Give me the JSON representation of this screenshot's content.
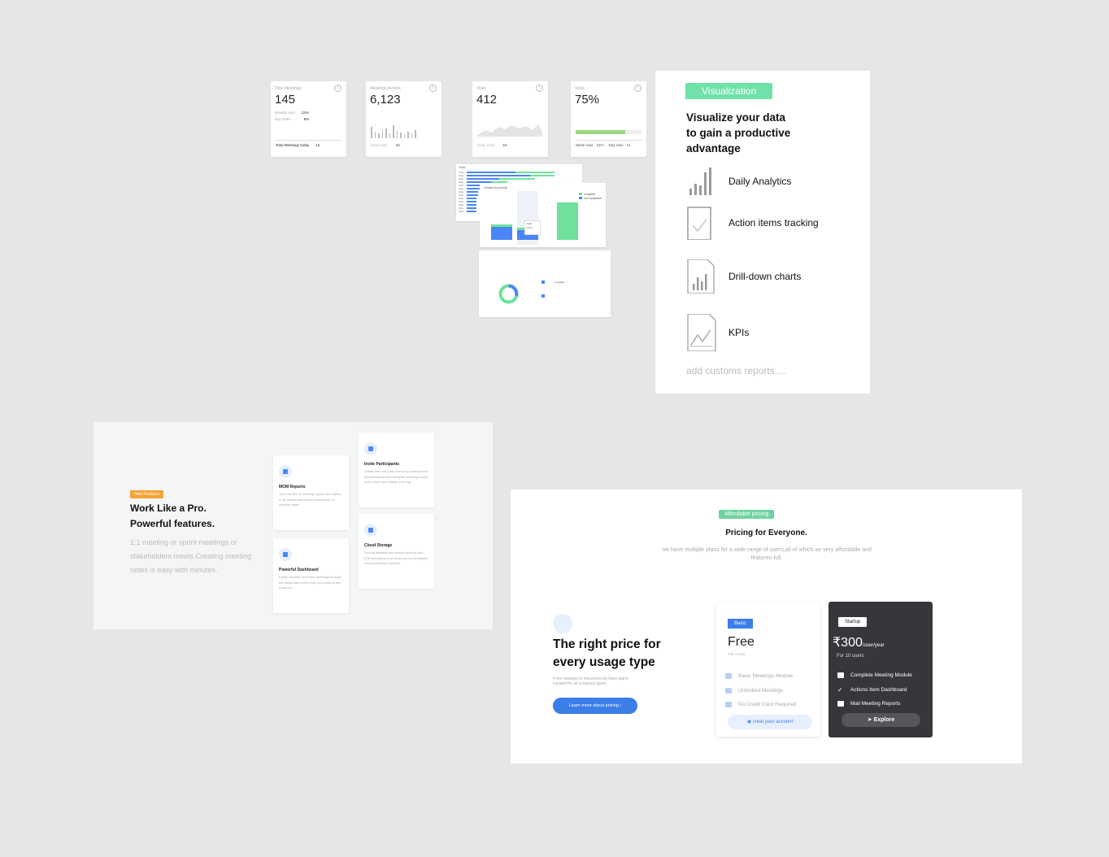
{
  "kpis": [
    {
      "label": "Total Meetings",
      "value": "145",
      "rows": [
        {
          "label": "Weekly ratio",
          "value": "12%"
        },
        {
          "label": "Day Ratio",
          "value": "8%"
        }
      ],
      "total_label": "Total Meetings today",
      "total_value": "12"
    },
    {
      "label": "Meetings Actions",
      "value": "6,123",
      "foot_label": "Daily stats",
      "foot_value": "24"
    },
    {
      "label": "Visits",
      "value": "412",
      "foot_label": "Daily visits",
      "foot_value": "24"
    },
    {
      "label": "Visits",
      "value": "75%",
      "progress": 0.75,
      "foot_label": "Week ratio",
      "foot_value": "24%",
      "foot2_label": "Day ratio",
      "foot2_value": "14"
    }
  ],
  "mini_charts": {
    "bar_chart_title": "Tool1",
    "bar_labels": [
      "Task",
      "Task",
      "Task",
      "Task",
      "Task",
      "Task",
      "Task",
      "Task",
      "Task",
      "Task",
      "Task",
      "Task",
      "Task"
    ],
    "column_chart_title": "Created by priority",
    "legend_complete": "complete",
    "legend_not_completed": "not completed",
    "tooltip_high": "High",
    "tooltip_total": "Total",
    "donut_legend": "complete"
  },
  "visualization": {
    "tag": "Visualization",
    "heading": "Visualize your data\n to gain a productive\nadvantage",
    "features": [
      {
        "icon": "bar-chart-icon",
        "label": "Daily Analytics"
      },
      {
        "icon": "checkbox-icon",
        "label": "Action items tracking"
      },
      {
        "icon": "document-chart-icon",
        "label": "Drill-down charts"
      },
      {
        "icon": "line-chart-icon",
        "label": "KPIs"
      }
    ],
    "more": "add customs reports...."
  },
  "features_section": {
    "tag": "New Features",
    "heading_line1": "Work Like a Pro.",
    "heading_line2": "Powerful features.",
    "description": "1:1 meeting or sprint meetings or stakeholders meets.Creating meeting notes is easy with minutes.",
    "cards": [
      {
        "icon": "report-icon",
        "title": "MOM Reports",
        "description": "Your minutes of meeting reports are mailed to all participants and reminds them for overdue tasks."
      },
      {
        "icon": "user-icon",
        "title": "Invite Participants",
        "description": "Collaborate with your teams by adding them as participants and delegate meetings tasks, even if they are outside your org."
      },
      {
        "icon": "list-icon",
        "title": "Powerful Dashboard",
        "description": "Easily visualize and track meetings through the dashboard which links your actions and progress."
      },
      {
        "icon": "cloud-icon",
        "title": "Cloud Storage",
        "description": "Your all activities are stored securely and E2E encrypted to provided you a completely secure business solution."
      }
    ]
  },
  "pricing": {
    "tag": "Affordable pricing",
    "title": "Pricing for  Everyone.",
    "description": "we have multiple plans for a wide range of users,all of which ae very affordable and features-full.",
    "heading_line1": "The right price for",
    "heading_line2": "every usage type",
    "subtext": "From startups to industries,we have plans curated for all company types.",
    "learn_button": "Learn more about pricing",
    "plans": [
      {
        "badge": "Basic",
        "price": "Free",
        "period": "",
        "subtitle": "For 1 user",
        "features": [
          "Basic Meetings Module",
          "Unlimited Meetings",
          "No Credit Card Required"
        ],
        "cta": "creat your account"
      },
      {
        "badge": "Startup",
        "price": "₹300",
        "period": "/user/year",
        "subtitle": "For 10 users",
        "features": [
          "Complete Meeting Module",
          "Actions Item Dashboard",
          "Mail Meeting Reports"
        ],
        "cta": "Explore"
      }
    ]
  },
  "colors": {
    "accent_green": "#6ee2a8",
    "accent_blue": "#3b7de9",
    "dark_card": "#36373a",
    "badge_orange": "#f5a233"
  }
}
